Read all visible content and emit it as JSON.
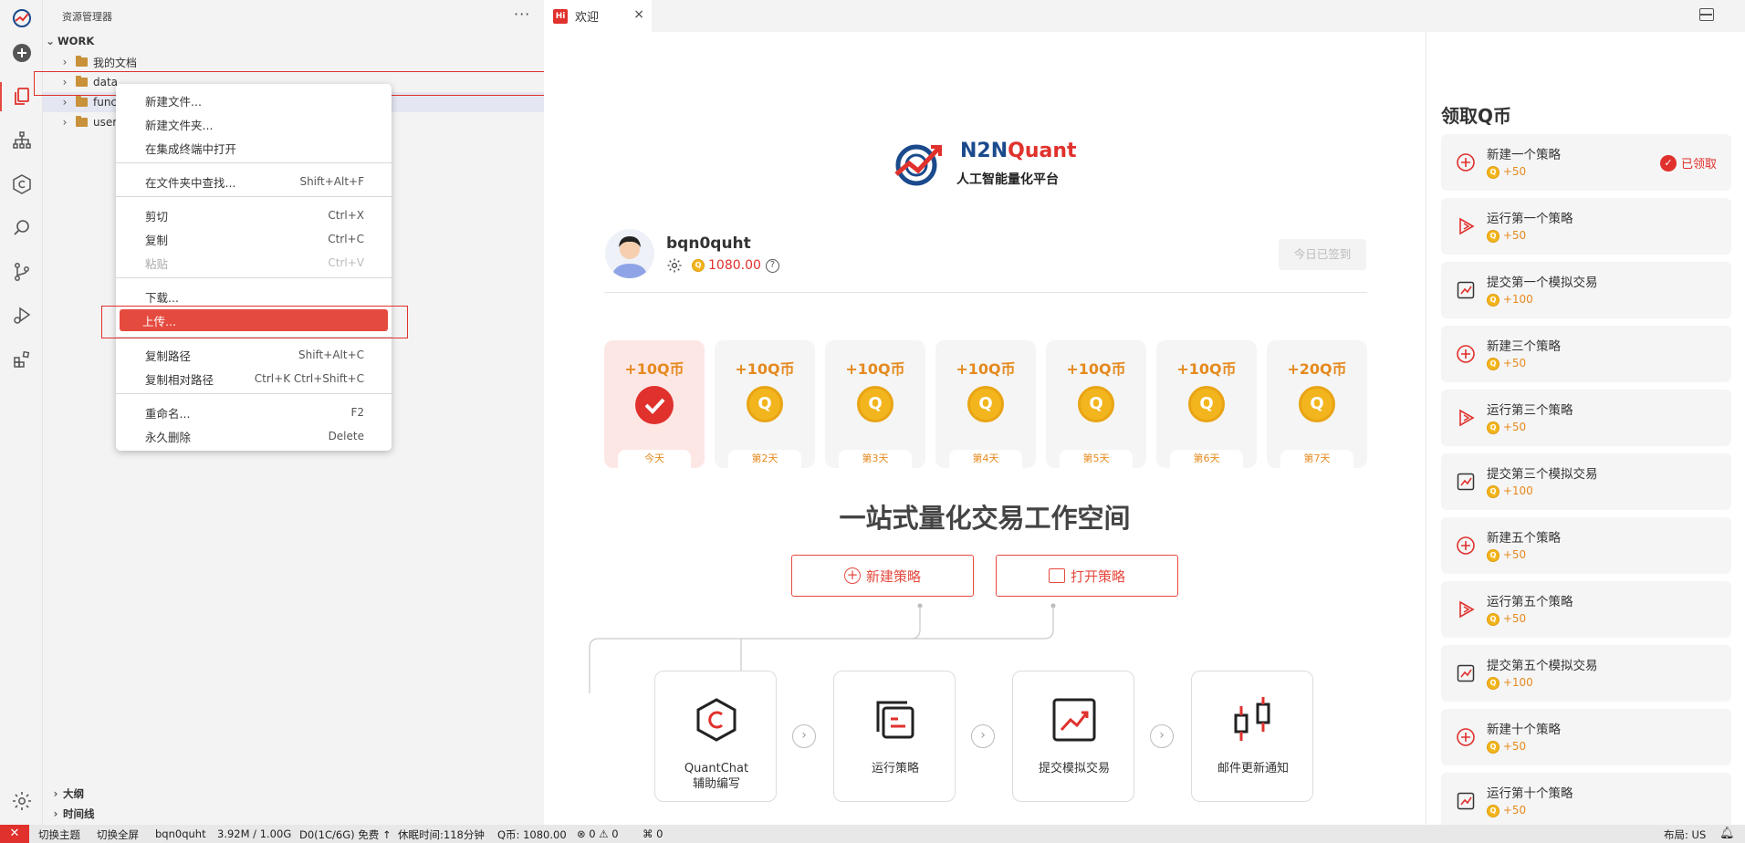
{
  "activity": {
    "icons": [
      "logo-icon",
      "add-icon",
      "explorer-icon",
      "hierarchy-icon",
      "quant-icon",
      "search-icon",
      "source-control-icon",
      "run-debug-icon",
      "extensions-icon",
      "settings-icon"
    ]
  },
  "explorer": {
    "title": "资源管理器",
    "more": "···",
    "root": "WORK",
    "items": [
      "我的文档",
      "data",
      "func",
      "user"
    ],
    "outline": "大纲",
    "timeline": "时间线"
  },
  "context_menu": {
    "items": [
      {
        "label": "新建文件..."
      },
      {
        "label": "新建文件夹..."
      },
      {
        "label": "在集成终端中打开"
      },
      {
        "label": "在文件夹中查找...",
        "key": "Shift+Alt+F"
      },
      {
        "label": "剪切",
        "key": "Ctrl+X"
      },
      {
        "label": "复制",
        "key": "Ctrl+C"
      },
      {
        "label": "粘贴",
        "key": "Ctrl+V"
      },
      {
        "label": "下载..."
      },
      {
        "label": "上传..."
      },
      {
        "label": "复制路径",
        "key": "Shift+Alt+C"
      },
      {
        "label": "复制相对路径",
        "key": "Ctrl+K Ctrl+Shift+C"
      },
      {
        "label": "重命名...",
        "key": "F2"
      },
      {
        "label": "永久删除",
        "key": "Delete"
      }
    ]
  },
  "tab": {
    "icon_text": "Hi",
    "label": "欢迎",
    "close": "×"
  },
  "brand": {
    "name_a": "N2N",
    "name_b": "Quant",
    "subtitle": "人工智能量化平台"
  },
  "user": {
    "name": "bqn0quht",
    "coins": "1080.00",
    "signin": "今日已签到"
  },
  "days": [
    {
      "value": "+10Q币",
      "label": "今天"
    },
    {
      "value": "+10Q币",
      "label": "第2天"
    },
    {
      "value": "+10Q币",
      "label": "第3天"
    },
    {
      "value": "+10Q币",
      "label": "第4天"
    },
    {
      "value": "+10Q币",
      "label": "第5天"
    },
    {
      "value": "+10Q币",
      "label": "第6天"
    },
    {
      "value": "+20Q币",
      "label": "第7天"
    }
  ],
  "coin_letter": "Q",
  "workspace": {
    "title": "一站式量化交易工作空间",
    "new_strategy": "新建策略",
    "open_strategy": "打开策略",
    "flow": [
      {
        "line1": "QuantChat",
        "line2": "辅助编写"
      },
      {
        "line1": "运行策略",
        "line2": ""
      },
      {
        "line1": "提交模拟交易",
        "line2": ""
      },
      {
        "line1": "邮件更新通知",
        "line2": ""
      }
    ]
  },
  "rewards": {
    "title": "领取Q币",
    "claimed": "已领取",
    "tasks": [
      {
        "name": "新建一个策略",
        "points": "+50",
        "icon": "plus-circle-icon"
      },
      {
        "name": "运行第一个策略",
        "points": "+50",
        "icon": "play-icon"
      },
      {
        "name": "提交第一个模拟交易",
        "points": "+100",
        "icon": "chart-icon"
      },
      {
        "name": "新建三个策略",
        "points": "+50",
        "icon": "plus-circle-icon"
      },
      {
        "name": "运行第三个策略",
        "points": "+50",
        "icon": "play-icon"
      },
      {
        "name": "提交第三个模拟交易",
        "points": "+100",
        "icon": "chart-icon"
      },
      {
        "name": "新建五个策略",
        "points": "+50",
        "icon": "plus-circle-icon"
      },
      {
        "name": "运行第五个策略",
        "points": "+50",
        "icon": "play-icon"
      },
      {
        "name": "提交第五个模拟交易",
        "points": "+100",
        "icon": "chart-icon"
      },
      {
        "name": "新建十个策略",
        "points": "+50",
        "icon": "plus-circle-icon"
      },
      {
        "name": "运行第十个策略",
        "points": "+50",
        "icon": "chart-icon"
      }
    ]
  },
  "status": {
    "theme": "切换主题",
    "fullscreen": "切换全屏",
    "user": "bqn0quht",
    "storage": "3.92M / 1.00G",
    "plan": "D0(1C/6G) 免费 ↑",
    "sleep": "休眠时间:118分钟",
    "coins": "Q币: 1080.00",
    "errors": "0",
    "warnings": "0",
    "ports": "0",
    "layout": "布局: US"
  },
  "colors": {
    "accent": "#e54a3f",
    "coin": "#f2b51d",
    "brand_blue": "#1b4a8c"
  }
}
